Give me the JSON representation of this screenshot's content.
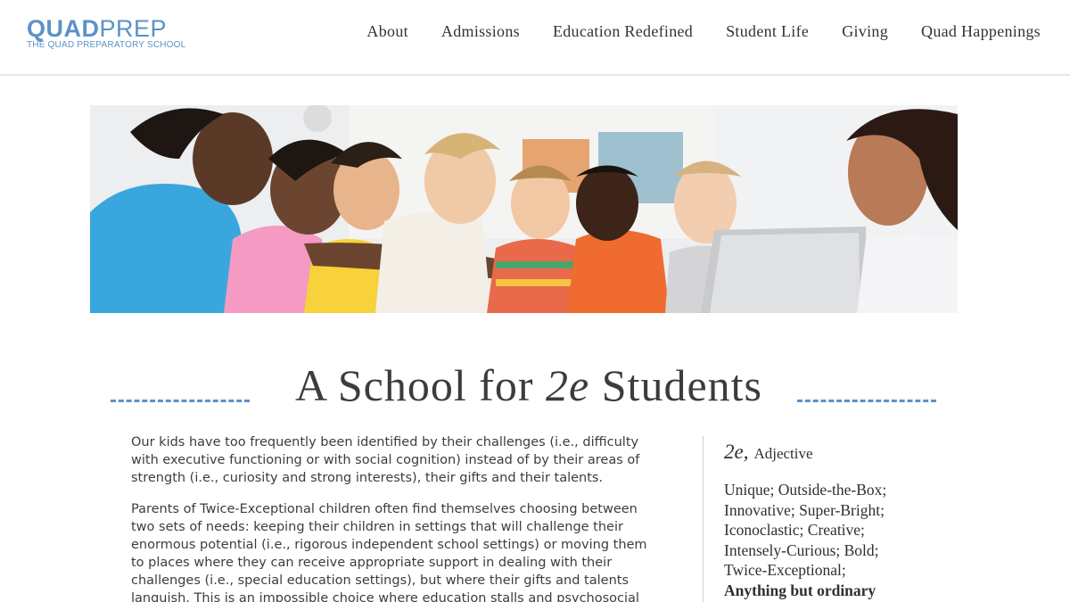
{
  "brand": {
    "name_part1": "QUAD",
    "name_part2": "PREP",
    "subtitle": "THE QUAD PREPARATORY SCHOOL",
    "color": "#5b92c9"
  },
  "nav": {
    "items": [
      {
        "label": "About"
      },
      {
        "label": "Admissions"
      },
      {
        "label": "Education Redefined"
      },
      {
        "label": "Student Life"
      },
      {
        "label": "Giving"
      },
      {
        "label": "Quad Happenings"
      }
    ]
  },
  "hero": {
    "image_icon": "classroom-photo"
  },
  "section": {
    "title_part1": "A School for ",
    "title_em": "2e",
    "title_part2": " Students"
  },
  "body": {
    "paragraphs": [
      "Our kids have too frequently been identified by their challenges (i.e., difficulty with executive functioning or with social cognition) instead of by their areas of strength (i.e., curiosity and strong interests), their gifts and their talents.",
      "Parents of Twice-Exceptional children often find themselves choosing between two sets of needs: keeping their children in settings that will challenge their enormous potential (i.e., rigorous independent school settings) or moving them to places where they can receive appropriate support in dealing with their challenges (i.e., special education settings), but where their gifts and talents languish. This is an impossible choice where education stalls and psychosocial"
    ]
  },
  "definition": {
    "term": "2e,",
    "part_of_speech": "Adjective",
    "lines": [
      "Unique; Outside-the-Box;",
      "Innovative; Super-Bright;",
      "Iconoclastic; Creative;",
      "Intensely-Curious; Bold;",
      "Twice-Exceptional;"
    ],
    "final_line": "Anything but ordinary"
  }
}
